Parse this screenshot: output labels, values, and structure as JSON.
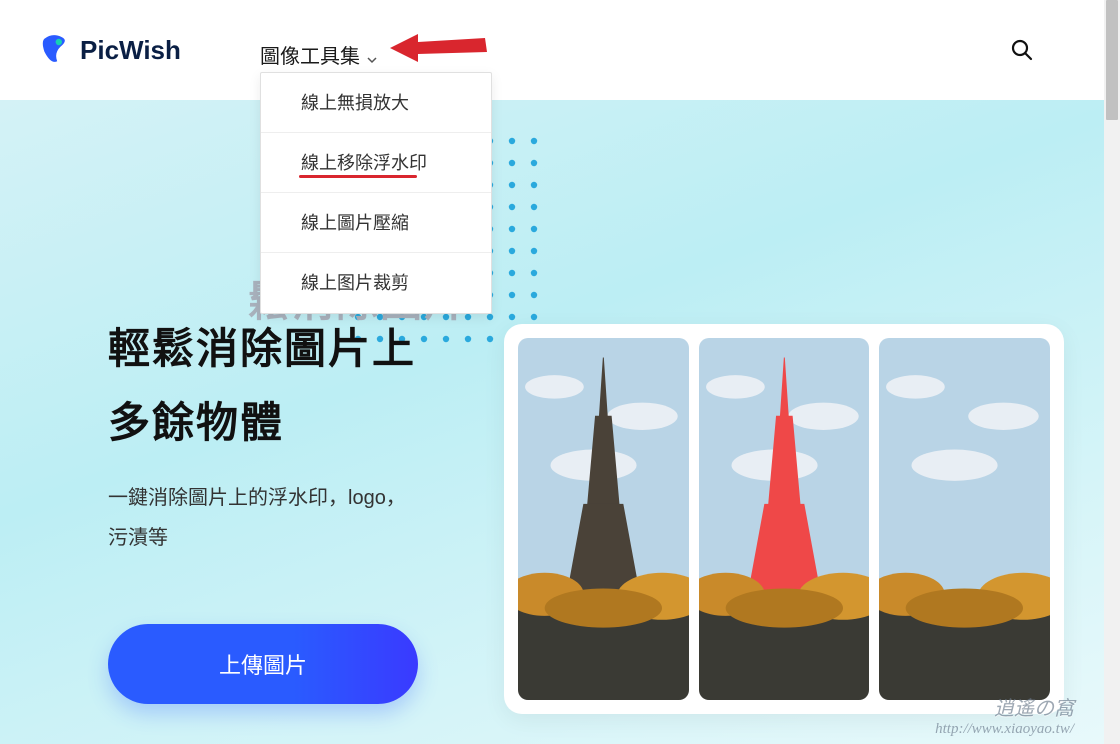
{
  "brand": {
    "name": "PicWish"
  },
  "nav": {
    "tools_label": "圖像工具集",
    "dropdown": [
      {
        "label": "線上無損放大"
      },
      {
        "label": "線上移除浮水印",
        "underlined": true
      },
      {
        "label": "線上圖片壓縮"
      },
      {
        "label": "線上图片裁剪"
      }
    ]
  },
  "hero": {
    "ghost_title_fragment": "鬆消除圖片",
    "headline_l1": "輕鬆消除圖片上",
    "headline_l2": "多餘物體",
    "subline_l1": "一鍵消除圖片上的浮水印，logo，",
    "subline_l2": "污漬等",
    "cta_label": "上傳圖片"
  },
  "panel": {
    "frames": [
      "original",
      "highlighted",
      "removed"
    ]
  },
  "watermark": {
    "title": "逍遙の窩",
    "url": "http://www.xiaoyao.tw/"
  },
  "icons": {
    "search": "search-icon",
    "chevron": "chevron-down-icon",
    "logo": "picwish-logo-icon",
    "arrow": "red-pointer-arrow"
  },
  "colors": {
    "brand_blue": "#2a5bff",
    "annot_red": "#d9262e",
    "hero_bg": "#bceef4"
  }
}
